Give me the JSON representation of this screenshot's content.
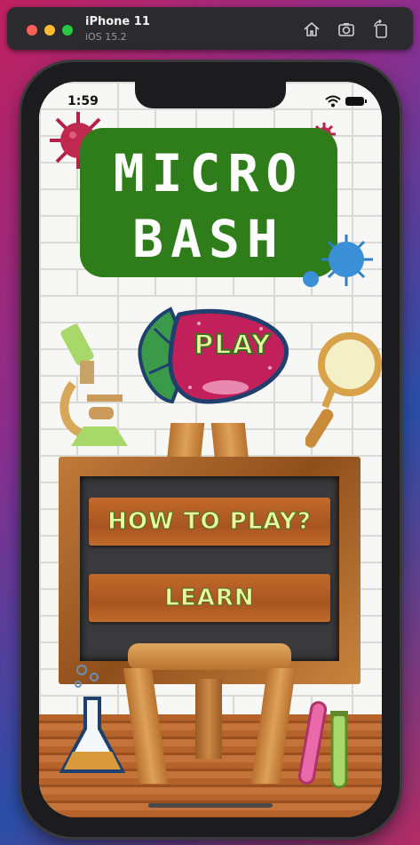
{
  "simulator": {
    "device_name": "iPhone 11",
    "os_version": "iOS 15.2",
    "buttons": [
      "home-icon",
      "screenshot-icon",
      "rotate-icon"
    ]
  },
  "status_bar": {
    "time": "1:59"
  },
  "game": {
    "title_line1": "MICRO",
    "title_line2": "BASH",
    "play_label": "PLAY",
    "how_to_play_label": "HOW TO PLAY?",
    "learn_label": "LEARN"
  },
  "colors": {
    "title_green": "#2e7d1a",
    "button_text": "#e9f7a0",
    "wood": "#a85520",
    "strawberry": "#c2205a"
  }
}
